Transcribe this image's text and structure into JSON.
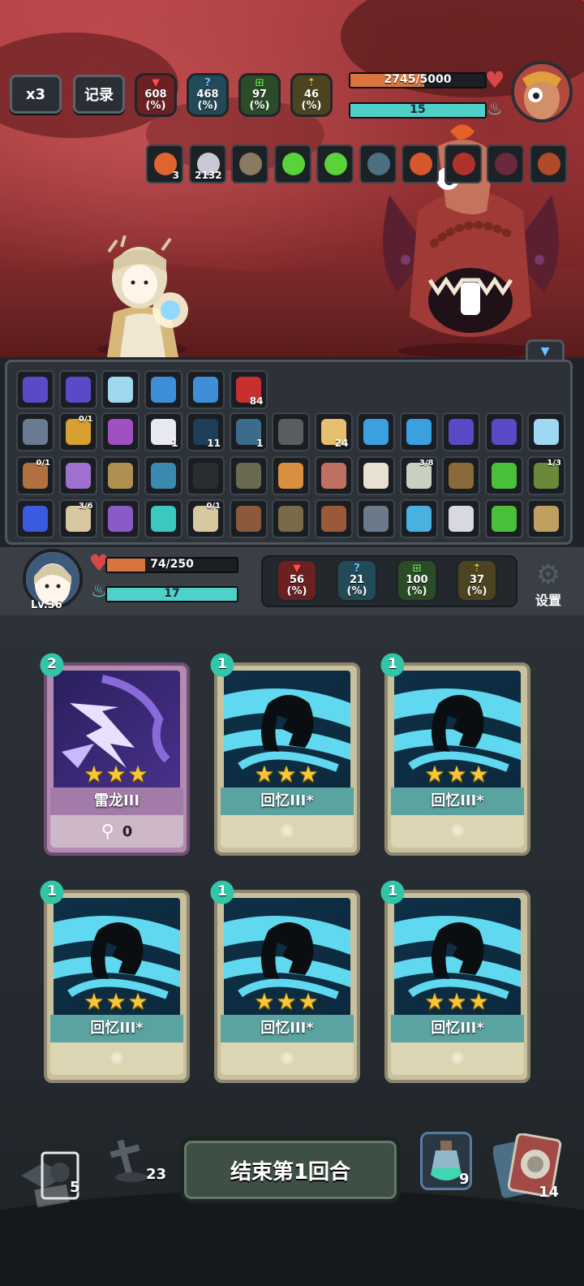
{
  "top": {
    "speed_label": "x3",
    "log_label": "记录",
    "enemy_stats": [
      {
        "value": "608",
        "unit": "(%)",
        "type": "attack",
        "color": "#ff4d4d"
      },
      {
        "value": "468",
        "unit": "(%)",
        "type": "crit",
        "color": "#69c8ff"
      },
      {
        "value": "97",
        "unit": "(%)",
        "type": "defense",
        "color": "#6fe25a"
      },
      {
        "value": "46",
        "unit": "(%)",
        "type": "pierce",
        "color": "#e6c550"
      }
    ],
    "enemy_hp": {
      "current": 2745,
      "max": 5000,
      "text": "2745/5000"
    },
    "enemy_energy": {
      "value": "15",
      "fill": 1.0
    }
  },
  "enemy_buffs": [
    {
      "icon": "fire-icon",
      "count": "3"
    },
    {
      "icon": "swirl-icon",
      "count": "2132"
    },
    {
      "icon": "book-icon",
      "count": ""
    },
    {
      "icon": "green-slime-icon",
      "count": ""
    },
    {
      "icon": "green-slime-icon",
      "count": ""
    },
    {
      "icon": "statue-icon",
      "count": ""
    },
    {
      "icon": "meteor-icon",
      "count": ""
    },
    {
      "icon": "claw-icon",
      "count": ""
    },
    {
      "icon": "wing-icon",
      "count": ""
    },
    {
      "icon": "beads-icon",
      "count": ""
    }
  ],
  "inventory": {
    "row1": [
      {
        "icon": "gem-orb-icon",
        "count": ""
      },
      {
        "icon": "gem-orb-icon",
        "count": ""
      },
      {
        "icon": "crystal-icon",
        "count": ""
      },
      {
        "icon": "lightning-icon",
        "count": ""
      },
      {
        "icon": "lightning-icon",
        "count": ""
      },
      {
        "icon": "slash-icon",
        "count": "84"
      }
    ],
    "row2": [
      {
        "icon": "staff-icon",
        "count": "",
        "frac": ""
      },
      {
        "icon": "lantern-icon",
        "count": "",
        "frac": "0/1"
      },
      {
        "icon": "crystals-icon",
        "count": "",
        "frac": ""
      },
      {
        "icon": "cat-icon",
        "count": "1",
        "frac": ""
      },
      {
        "icon": "shadow-icon",
        "count": "11",
        "frac": ""
      },
      {
        "icon": "shield-icon",
        "count": "1",
        "frac": ""
      },
      {
        "icon": "stone-ring-icon",
        "count": "",
        "frac": ""
      },
      {
        "icon": "horn-icon",
        "count": "24",
        "frac": ""
      },
      {
        "icon": "blue-gem-icon",
        "count": "",
        "frac": ""
      },
      {
        "icon": "blue-gem-icon",
        "count": "",
        "frac": ""
      },
      {
        "icon": "gem-orb-icon",
        "count": "",
        "frac": ""
      },
      {
        "icon": "gem-orb-icon",
        "count": "",
        "frac": ""
      },
      {
        "icon": "crystal-icon",
        "count": "",
        "frac": ""
      }
    ],
    "row3": [
      {
        "icon": "feather-icon",
        "frac": "0/1"
      },
      {
        "icon": "egg-icon",
        "frac": ""
      },
      {
        "icon": "helmet-icon",
        "frac": ""
      },
      {
        "icon": "swirl-orb-icon",
        "frac": ""
      },
      {
        "icon": "pot-icon",
        "frac": ""
      },
      {
        "icon": "armor-icon",
        "frac": ""
      },
      {
        "icon": "potion-icon",
        "frac": ""
      },
      {
        "icon": "doll-icon",
        "frac": ""
      },
      {
        "icon": "domino-icon",
        "frac": ""
      },
      {
        "icon": "blade-icon",
        "frac": "3/8"
      },
      {
        "icon": "bronze-helmet-icon",
        "frac": ""
      },
      {
        "icon": "slime-icon",
        "frac": ""
      },
      {
        "icon": "frog-icon",
        "frac": "1/3"
      }
    ],
    "row4": [
      {
        "icon": "sword-icon",
        "frac": ""
      },
      {
        "icon": "scroll-icon",
        "frac": "3/6"
      },
      {
        "icon": "crystal-ball-icon",
        "frac": ""
      },
      {
        "icon": "teal-orb-icon",
        "frac": ""
      },
      {
        "icon": "bone-icon",
        "frac": "0/1"
      },
      {
        "icon": "cauldron-icon",
        "frac": ""
      },
      {
        "icon": "backpack-icon",
        "frac": ""
      },
      {
        "icon": "gear-icon",
        "frac": ""
      },
      {
        "icon": "bug-icon",
        "frac": ""
      },
      {
        "icon": "water-icon",
        "frac": ""
      },
      {
        "icon": "ghost-icon",
        "frac": ""
      },
      {
        "icon": "slime-icon",
        "frac": ""
      },
      {
        "icon": "hourglass-icon",
        "frac": ""
      }
    ]
  },
  "player": {
    "level": "Lv.36",
    "hp": {
      "current": 74,
      "max": 250,
      "text": "74/250"
    },
    "energy": {
      "value": "17",
      "fill": 1.0
    },
    "stats": [
      {
        "value": "56",
        "unit": "(%)",
        "type": "attack",
        "color": "#ff4d4d"
      },
      {
        "value": "21",
        "unit": "(%)",
        "type": "crit",
        "color": "#69c8ff"
      },
      {
        "value": "100",
        "unit": "(%)",
        "type": "defense",
        "color": "#6fe25a"
      },
      {
        "value": "37",
        "unit": "(%)",
        "type": "pierce",
        "color": "#e6c550"
      }
    ],
    "settings_label": "设置"
  },
  "cards": [
    {
      "cost": "2",
      "name": "雷龙III",
      "stars": "★★★",
      "style": "purple",
      "footer": "0"
    },
    {
      "cost": "1",
      "name": "回忆III*",
      "stars": "★★★",
      "style": "teal",
      "footer": ""
    },
    {
      "cost": "1",
      "name": "回忆III*",
      "stars": "★★★",
      "style": "teal",
      "footer": ""
    },
    {
      "cost": "1",
      "name": "回忆III*",
      "stars": "★★★",
      "style": "teal",
      "footer": ""
    },
    {
      "cost": "1",
      "name": "回忆III*",
      "stars": "★★★",
      "style": "teal",
      "footer": ""
    },
    {
      "cost": "1",
      "name": "回忆III*",
      "stars": "★★★",
      "style": "teal",
      "footer": ""
    }
  ],
  "bottom": {
    "draw_pile": "5",
    "discard_pile": "23",
    "end_turn_label": "结束第1回合",
    "potion_count": "9",
    "deck_count": "14"
  }
}
